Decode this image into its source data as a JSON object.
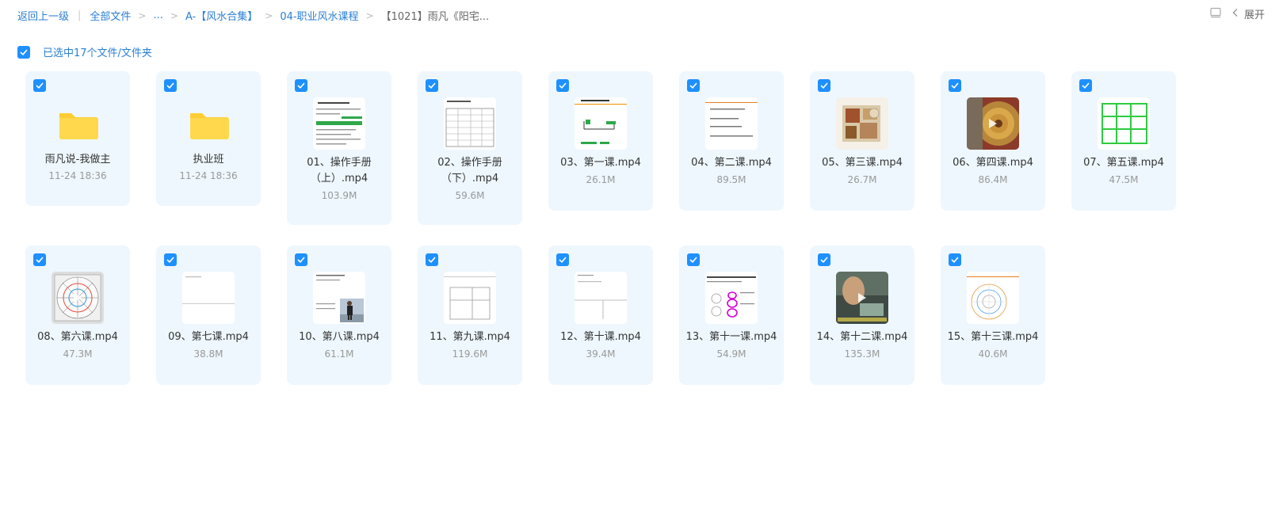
{
  "breadcrumb": {
    "back": "返回上一级",
    "items": [
      "全部文件",
      "...",
      "A-【风水合集】",
      "04-职业风水课程",
      "【1021】雨凡《阳宅..."
    ]
  },
  "toolbar": {
    "expand_label": "展开"
  },
  "selection": {
    "text": "已选中17个文件/文件夹"
  },
  "files": [
    {
      "name": "雨凡说-我做主",
      "meta": "11-24 18:36",
      "kind": "folder",
      "icon": "folder-icon"
    },
    {
      "name": "执业班",
      "meta": "11-24 18:36",
      "kind": "folder",
      "icon": "folder-icon"
    },
    {
      "name": "01、操作手册（上）.mp4",
      "meta": "103.9M",
      "kind": "video",
      "icon": "document-thumbnail"
    },
    {
      "name": "02、操作手册（下）.mp4",
      "meta": "59.6M",
      "kind": "video",
      "icon": "table-thumbnail"
    },
    {
      "name": "03、第一课.mp4",
      "meta": "26.1M",
      "kind": "video",
      "icon": "slide-thumbnail"
    },
    {
      "name": "04、第二课.mp4",
      "meta": "89.5M",
      "kind": "video",
      "icon": "text-thumbnail"
    },
    {
      "name": "05、第三课.mp4",
      "meta": "26.7M",
      "kind": "video",
      "icon": "floorplan-thumbnail"
    },
    {
      "name": "06、第四课.mp4",
      "meta": "86.4M",
      "kind": "video",
      "icon": "compass-thumbnail"
    },
    {
      "name": "07、第五课.mp4",
      "meta": "47.5M",
      "kind": "video",
      "icon": "grid-thumbnail"
    },
    {
      "name": "08、第六课.mp4",
      "meta": "47.3M",
      "kind": "video",
      "icon": "luopan-thumbnail"
    },
    {
      "name": "09、第七课.mp4",
      "meta": "38.8M",
      "kind": "video",
      "icon": "blank-thumbnail"
    },
    {
      "name": "10、第八课.mp4",
      "meta": "61.1M",
      "kind": "video",
      "icon": "person-thumbnail"
    },
    {
      "name": "11、第九课.mp4",
      "meta": "119.6M",
      "kind": "video",
      "icon": "diagram-thumbnail"
    },
    {
      "name": "12、第十课.mp4",
      "meta": "39.4M",
      "kind": "video",
      "icon": "sketch-thumbnail"
    },
    {
      "name": "13、第十一课.mp4",
      "meta": "54.9M",
      "kind": "video",
      "icon": "annotated-thumbnail"
    },
    {
      "name": "14、第十二课.mp4",
      "meta": "135.3M",
      "kind": "video",
      "icon": "camera-thumbnail"
    },
    {
      "name": "15、第十三课.mp4",
      "meta": "40.6M",
      "kind": "video",
      "icon": "chart-thumbnail"
    }
  ],
  "colors": {
    "accent": "#1e90ff",
    "link": "#2a7fd4",
    "card_bg": "#eef7fd",
    "folder": "#ffcc33"
  }
}
